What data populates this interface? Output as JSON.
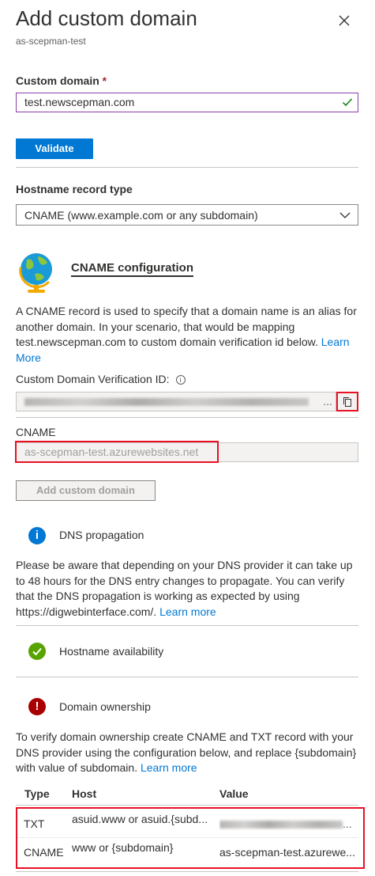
{
  "header": {
    "title": "Add custom domain",
    "subtitle": "as-scepman-test"
  },
  "custom_domain": {
    "label": "Custom domain",
    "required_mark": "*",
    "value": "test.newscepman.com"
  },
  "validate_button": "Validate",
  "hostname_record": {
    "label": "Hostname record type",
    "selected": "CNAME (www.example.com or any subdomain)"
  },
  "cname_config": {
    "title": "CNAME configuration",
    "description": "A CNAME record is used to specify that a domain name is an alias for another domain. In your scenario, that would be mapping test.newscepman.com to custom domain verification id below.",
    "learn_more": "Learn More",
    "verification_label": "Custom Domain Verification ID:",
    "verification_info_icon": "info-icon",
    "verification_ellipsis": "...",
    "cname_label": "CNAME",
    "cname_value": "as-scepman-test.azurewebsites.net"
  },
  "add_custom_domain_button": "Add custom domain",
  "dns_propagation": {
    "title": "DNS propagation",
    "text": "Please be aware that depending on your DNS provider it can take up to 48 hours for the DNS entry changes to propagate. You can verify that the DNS propagation is working as expected by using https://digwebinterface.com/.",
    "learn_more": "Learn more"
  },
  "hostname_availability": {
    "title": "Hostname availability"
  },
  "domain_ownership": {
    "title": "Domain ownership",
    "text": "To verify domain ownership create CNAME and TXT record with your DNS provider using the configuration below, and replace {subdomain} with value of subdomain.",
    "learn_more": "Learn more"
  },
  "records_table": {
    "headers": [
      "Type",
      "Host",
      "Value"
    ],
    "rows": [
      {
        "type": "TXT",
        "host": "asuid.www or asuid.{subd...",
        "value": "..."
      },
      {
        "type": "CNAME",
        "host": "www or {subdomain}",
        "value": "as-scepman-test.azurewe..."
      }
    ]
  },
  "colors": {
    "accent": "#0078d4",
    "error": "#a4262c",
    "highlight": "#e81123",
    "success": "#57a300",
    "danger": "#a80000"
  }
}
